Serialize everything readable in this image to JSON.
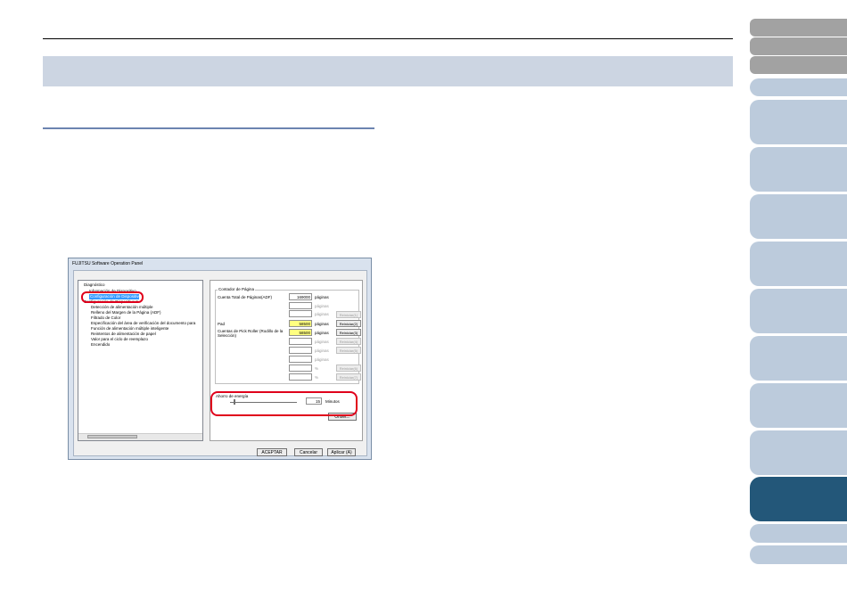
{
  "dialog": {
    "title": "FUJITSU Software Operation Panel",
    "tree": [
      "Diagnóstico",
      "Información de Dispositivo",
      "Configuración de Dispositivo",
      "Configuración de Dispositivo 2",
      "Detección de alimentación múltiple",
      "Relleno del Margen de la Página (ADF)",
      "Filtrado de Color",
      "Especificación del área de verificación del documento para",
      "Función de alimentación múltiple inteligente",
      "Reintentos de alimentación de papel",
      "Valor para el ciclo de reemplazo",
      "Encendido"
    ],
    "counter": {
      "group_label": "Contador de Página",
      "total_label": "Cuenta Total de Páginas(ADF)",
      "total_value": "169000",
      "unit": "páginas",
      "pad_label": "Pad",
      "pad_value": "58500",
      "pick_label": "Cuentas de Pick Roller (Rodillo de la Selección)",
      "pick_value": "58500",
      "percent": "%",
      "reset": "Reiniciar(1)",
      "reset_pad": "Reiniciar(2)",
      "reset_pick": "Reiniciar(3)",
      "reset_4": "Reiniciar(4)",
      "reset_5": "Reiniciar(5)",
      "reset_6": "Reiniciar(6)",
      "reset_7": "Reiniciar(7)"
    },
    "energy": {
      "label": "Ahorro de energía",
      "value": "15",
      "unit": "Minutos"
    },
    "offset_button": "Offset...",
    "ok_button": "ACEPTAR",
    "cancel_button": "Cancelar",
    "apply_button": "Aplicar (A)"
  },
  "highlight_color": "#e0001b",
  "selected_tab_color": "#235779"
}
